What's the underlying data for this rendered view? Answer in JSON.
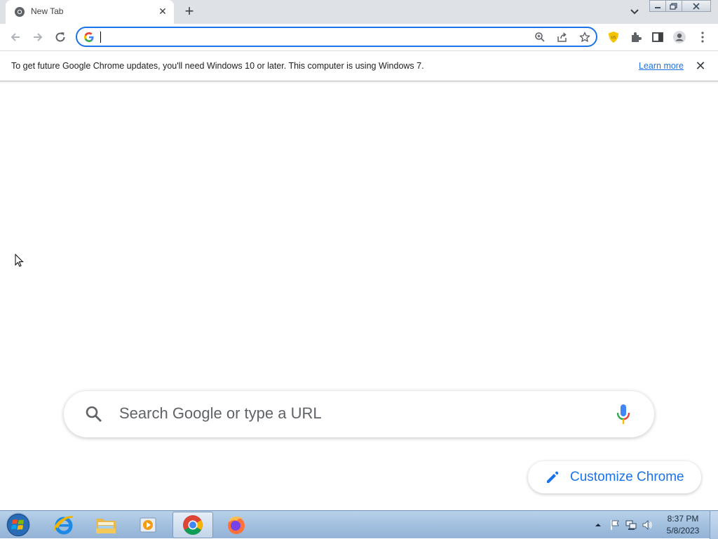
{
  "browser": {
    "tab": {
      "title": "New Tab",
      "close_glyph": "✕"
    },
    "new_tab_glyph": "+",
    "omnibox": {
      "value": "",
      "placeholder": ""
    },
    "icons": [
      "back-icon",
      "forward-icon",
      "reload-icon",
      "google-g-icon",
      "zoom-icon",
      "share-icon",
      "bookmark-star-icon",
      "extension-shield-icon",
      "puzzle-icon",
      "side-panel-icon",
      "profile-icon",
      "menu-icon"
    ]
  },
  "infobar": {
    "message": "To get future Google Chrome updates, you'll need Windows 10 or later. This computer is using Windows 7.",
    "link": "Learn more",
    "close_glyph": "✕"
  },
  "ntp": {
    "search_placeholder": "Search Google or type a URL",
    "customize_label": "Customize Chrome"
  },
  "taskbar": {
    "apps": [
      "internet-explorer",
      "windows-explorer",
      "media-player",
      "google-chrome",
      "firefox"
    ],
    "time": "8:37 PM",
    "date": "5/8/2023"
  },
  "colors": {
    "accent": "#1a73e8",
    "tabstrip": "#dee1e6"
  }
}
